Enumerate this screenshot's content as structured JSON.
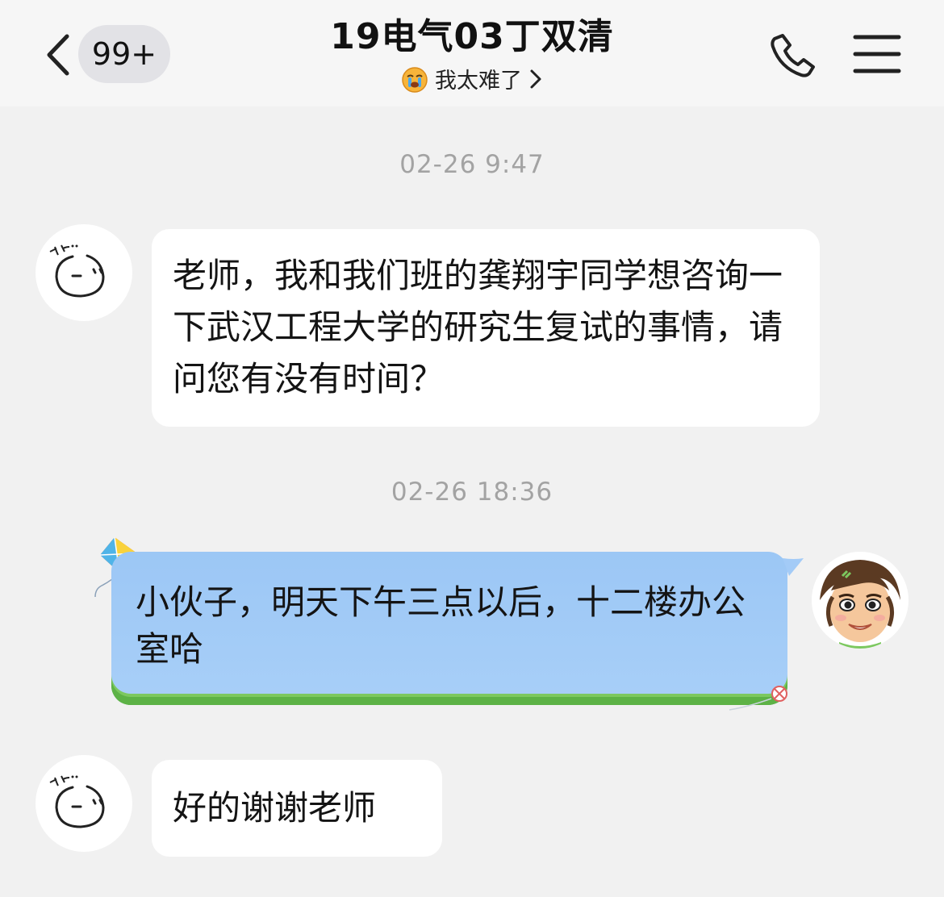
{
  "header": {
    "back_icon": "chevron-left-icon",
    "unread_count": "99+",
    "title": "19电气03丁双清",
    "status_emoji": "crying-face-icon",
    "status_text": "我太难了",
    "phone_icon": "phone-icon",
    "menu_icon": "menu-icon"
  },
  "messages": [
    {
      "timestamp": "02-26 9:47",
      "sender": "other",
      "text": "老师，我和我们班的龚翔宇同学想咨询一下武汉工程大学的研究生复试的事情，请问您有没有时间？"
    },
    {
      "timestamp": "02-26 18:36",
      "sender": "self",
      "text": "小伙子，明天下午三点以后，十二楼办公室哈"
    },
    {
      "sender": "other",
      "text": "好的谢谢老师"
    }
  ],
  "colors": {
    "background": "#f1f1f1",
    "self_bubble": "#a3cbf7",
    "other_bubble": "#ffffff",
    "timestamp": "#a3a3a3"
  }
}
